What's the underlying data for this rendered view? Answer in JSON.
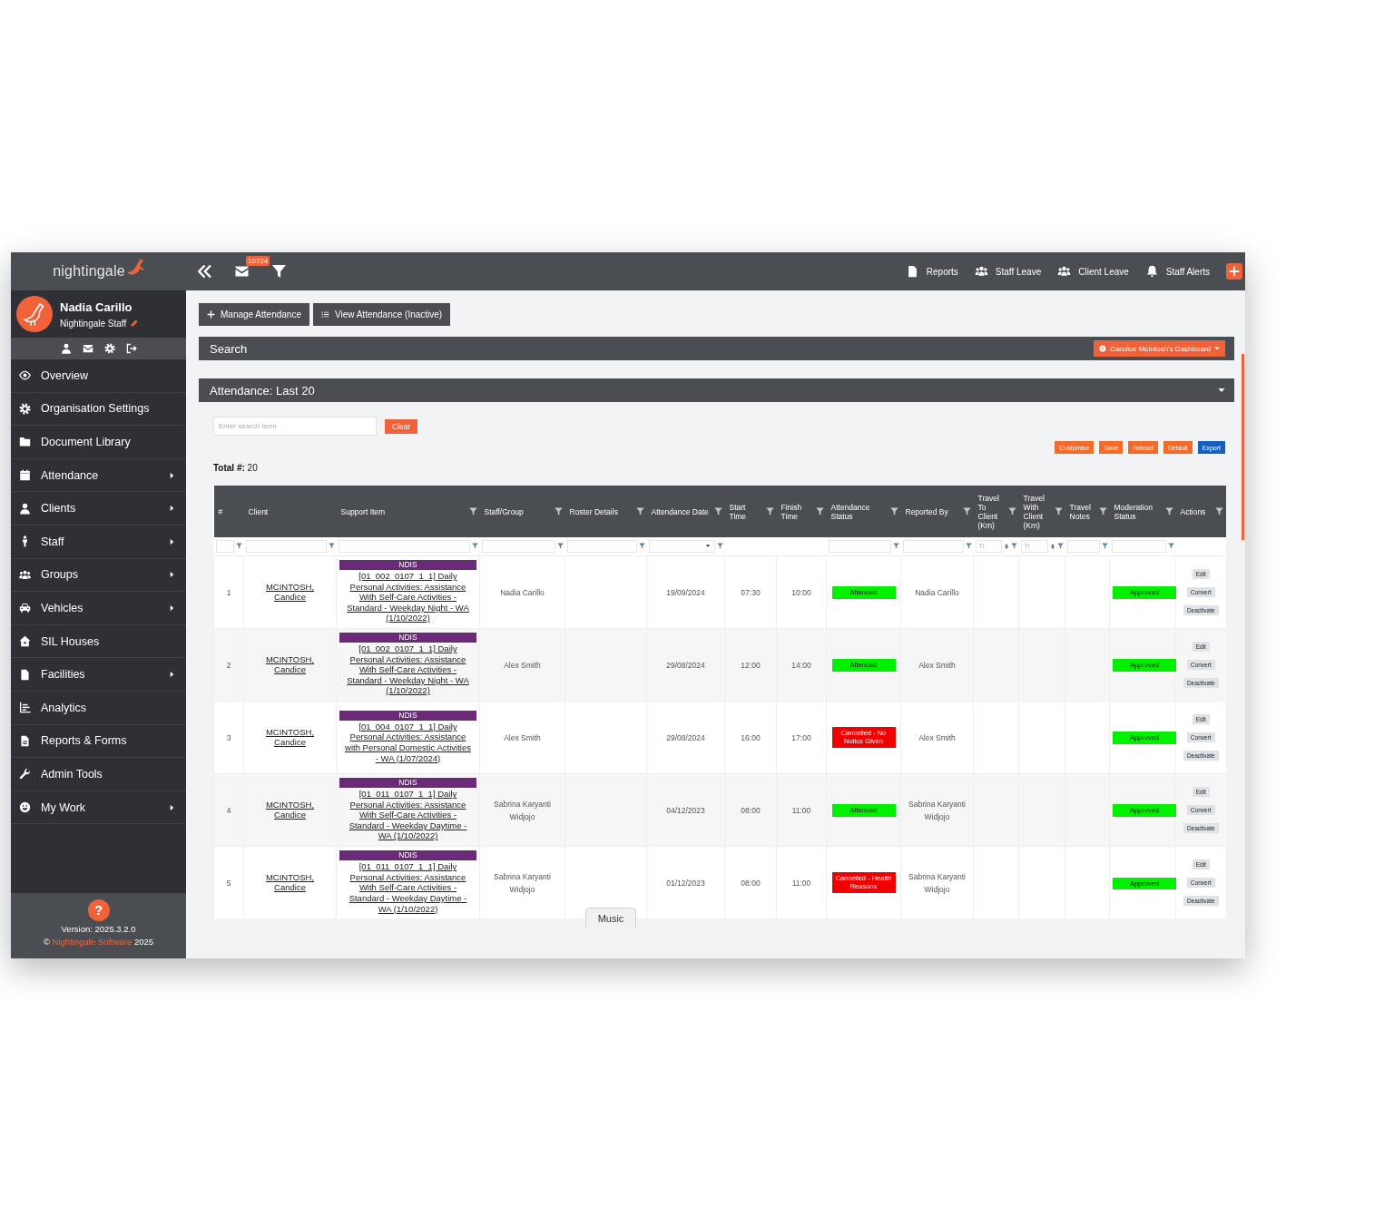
{
  "sidebar": {
    "logo": "nightingale",
    "user": {
      "name": "Nadia Carillo",
      "role": "Nightingale Staff"
    },
    "menu": [
      {
        "label": "Overview",
        "has_submenu": false,
        "selected": false
      },
      {
        "label": "Organisation Settings",
        "has_submenu": false,
        "selected": false
      },
      {
        "label": "Document Library",
        "has_submenu": false,
        "selected": false
      },
      {
        "label": "Attendance",
        "has_submenu": true,
        "selected": false
      },
      {
        "label": "Clients",
        "has_submenu": true,
        "selected": false
      },
      {
        "label": "Staff",
        "has_submenu": true,
        "selected": false
      },
      {
        "label": "Groups",
        "has_submenu": true,
        "selected": false
      },
      {
        "label": "Vehicles",
        "has_submenu": true,
        "selected": false
      },
      {
        "label": "SIL Houses",
        "has_submenu": false,
        "selected": false
      },
      {
        "label": "Facilities",
        "has_submenu": true,
        "selected": false
      },
      {
        "label": "Analytics",
        "has_submenu": false,
        "selected": false
      },
      {
        "label": "Reports & Forms",
        "has_submenu": false,
        "selected": false
      },
      {
        "label": "Admin Tools",
        "has_submenu": false,
        "selected": false
      },
      {
        "label": "My Work",
        "has_submenu": true,
        "selected": false
      }
    ],
    "footer": {
      "help": "?",
      "version": "Version: 2025.3.2.0",
      "copyright": "©",
      "company": "Nightingale Software",
      "year": "2025"
    }
  },
  "topbar": {
    "unread_count": "10724",
    "links": [
      "Reports",
      "Staff Leave",
      "Client Leave",
      "Staff Alerts"
    ]
  },
  "toolbar": [
    "Manage Attendance",
    "View Attendance (Inactive)"
  ],
  "search_panel": {
    "title": "Search",
    "dashboard_button": "Candice McIntosh's Dashboard"
  },
  "attendance_panel": {
    "title": "Attendance: Last 20",
    "expanded": true,
    "search": {
      "placeholder": "Enter search term"
    },
    "clear_button": "Clear",
    "grid_buttons": [
      {
        "label": "Customise",
        "color": "#f26b2a"
      },
      {
        "label": "Save",
        "color": "#f26b2a"
      },
      {
        "label": "Reload",
        "color": "#f26b2a"
      },
      {
        "label": "Default",
        "color": "#f26b2a"
      },
      {
        "label": "Export",
        "color": "#1560bd"
      }
    ],
    "total": "**Total #:** 20",
    "table": {
      "columns": [
        {
          "label": "#",
          "filter_icon": false,
          "filter": {
            "kind": "text"
          }
        },
        {
          "label": "Client",
          "filter_icon": false,
          "filter": {
            "kind": "text"
          }
        },
        {
          "label": "Support Item",
          "filter_icon": true,
          "filter": {
            "kind": "text"
          }
        },
        {
          "label": "Staff/Group",
          "filter_icon": true,
          "filter": {
            "kind": "text"
          }
        },
        {
          "label": "Roster Details",
          "filter_icon": true,
          "filter": {
            "kind": "text"
          }
        },
        {
          "label": "Attendance Date",
          "filter_icon": true,
          "filter": {
            "kind": "select"
          }
        },
        {
          "label": "Start Time",
          "filter_icon": true
        },
        {
          "label": "Finish Time",
          "filter_icon": true
        },
        {
          "label": "Attendance Status",
          "filter_icon": true,
          "filter": {
            "kind": "text"
          }
        },
        {
          "label": "Reported By",
          "filter_icon": true,
          "filter": {
            "kind": "text"
          }
        },
        {
          "label": "Travel To Client (Km)",
          "filter_icon": true,
          "filter": {
            "kind": "number",
            "placeholder": "Ti"
          }
        },
        {
          "label": "Travel With Client (Km)",
          "filter_icon": true,
          "filter": {
            "kind": "number",
            "placeholder": "Ti"
          }
        },
        {
          "label": "Travel Notes",
          "filter_icon": true,
          "filter": {
            "kind": "text"
          }
        },
        {
          "label": "Moderation Status",
          "filter_icon": true,
          "filter": {
            "kind": "text"
          }
        },
        {
          "label": "Actions",
          "filter_icon": true
        }
      ],
      "rows": [
        {
          "number": "1",
          "client": "MCINTOSH, Candice",
          "funding": "NDIS",
          "support_item": "[01_002_0107_1_1] Daily Personal Activities: Assistance With Self-Care Activities - Standard - Weekday Night - WA (1/10/2022)",
          "staff_group": "Nadia Carillo",
          "attendance_date": "19/09/2024",
          "start_time": "07:30",
          "finish_time": "10:00",
          "attendance_status": {
            "text": "Attended",
            "color": "#00f000"
          },
          "reported_by": "Nadia Carillo",
          "moderation_status": {
            "text": "Approved",
            "color": "#00f000"
          },
          "actions": [
            "Edit",
            "Convert",
            "Deactivate"
          ]
        },
        {
          "number": "2",
          "client": "MCINTOSH, Candice",
          "funding": "NDIS",
          "support_item": "[01_002_0107_1_1] Daily Personal Activities: Assistance With Self-Care Activities - Standard - Weekday Night - WA (1/10/2022)",
          "staff_group": "Alex Smith",
          "attendance_date": "29/08/2024",
          "start_time": "12:00",
          "finish_time": "14:00",
          "attendance_status": {
            "text": "Attended",
            "color": "#00f000"
          },
          "reported_by": "Alex Smith",
          "moderation_status": {
            "text": "Approved",
            "color": "#00f000"
          },
          "actions": [
            "Edit",
            "Convert",
            "Deactivate"
          ]
        },
        {
          "number": "3",
          "client": "MCINTOSH, Candice",
          "funding": "NDIS",
          "support_item": "[01_004_0107_1_1] Daily Personal Activities: Assistance with Personal Domestic Activities - WA (1/07/2024)",
          "staff_group": "Alex Smith",
          "attendance_date": "29/08/2024",
          "start_time": "16:00",
          "finish_time": "17:00",
          "attendance_status": {
            "text": "Cancelled - No Notice Given",
            "color": "#f00000"
          },
          "reported_by": "Alex Smith",
          "moderation_status": {
            "text": "Approved",
            "color": "#00f000"
          },
          "actions": [
            "Edit",
            "Convert",
            "Deactivate"
          ]
        },
        {
          "number": "4",
          "client": "MCINTOSH, Candice",
          "funding": "NDIS",
          "support_item": "[01_011_0107_1_1] Daily Personal Activities: Assistance With Self-Care Activities - Standard - Weekday Daytime - WA (1/10/2022)",
          "staff_group": "Sabrina Karyanti Widjojo",
          "attendance_date": "04/12/2023",
          "start_time": "08:00",
          "finish_time": "11:00",
          "attendance_status": {
            "text": "Attended",
            "color": "#00f000"
          },
          "reported_by": "Sabrina Karyanti Widjojo",
          "moderation_status": {
            "text": "Approved",
            "color": "#00f000"
          },
          "actions": [
            "Edit",
            "Convert",
            "Deactivate"
          ]
        },
        {
          "number": "5",
          "client": "MCINTOSH, Candice",
          "funding": "NDIS",
          "support_item": "[01_011_0107_1_1] Daily Personal Activities: Assistance With Self-Care Activities - Standard - Weekday Daytime - WA (1/10/2022)",
          "staff_group": "Sabrina Karyanti Widjojo",
          "attendance_date": "01/12/2023",
          "start_time": "08:00",
          "finish_time": "11:00",
          "attendance_status": {
            "text": "Cancelled - Health Reasons",
            "color": "#f00000"
          },
          "reported_by": "Sabrina Karyanti Widjojo",
          "moderation_status": {
            "text": "Approved",
            "color": "#00f000"
          },
          "actions": [
            "Edit",
            "Convert",
            "Deactivate"
          ]
        }
      ]
    }
  },
  "music_tab": "Music"
}
